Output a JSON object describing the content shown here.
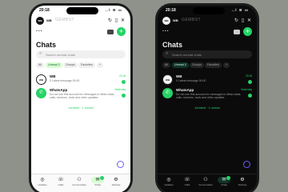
{
  "status": {
    "time": "20:18",
    "system": "..l ≋ ▭"
  },
  "top": {
    "brand": "WB",
    "banner": "GEMBST",
    "logo": "WB"
  },
  "header": {
    "more": "···",
    "new_icon": "+",
    "camera_icon": "camera-icon"
  },
  "title": "Chats",
  "search": {
    "placeholder": "Search unread chats",
    "icon": "search-icon"
  },
  "chips": [
    "All",
    "Unread 2",
    "Groups",
    "Favorites",
    "+"
  ],
  "chats": [
    {
      "name": "WB",
      "avatar": "WB",
      "message": "0 Latest message 00:00",
      "time": "20:18"
    },
    {
      "name": "WhatsApp",
      "avatar": "✆",
      "message": "Do not use this account for messages in Meta chats, calls, services, tools and other updates.",
      "time": "Yesterday"
    }
  ],
  "archived": "Archived · 1 unread",
  "tabs": [
    {
      "icon": "◎",
      "label": "Updates"
    },
    {
      "icon": "☏",
      "label": "Calls"
    },
    {
      "icon": "⚇",
      "label": "Communities"
    },
    {
      "icon": "✉",
      "label": "Chats"
    },
    {
      "icon": "⚙",
      "label": "Settings"
    }
  ],
  "colors": {
    "accent": "#25d366",
    "meta_ai": "#6b5cf6"
  }
}
